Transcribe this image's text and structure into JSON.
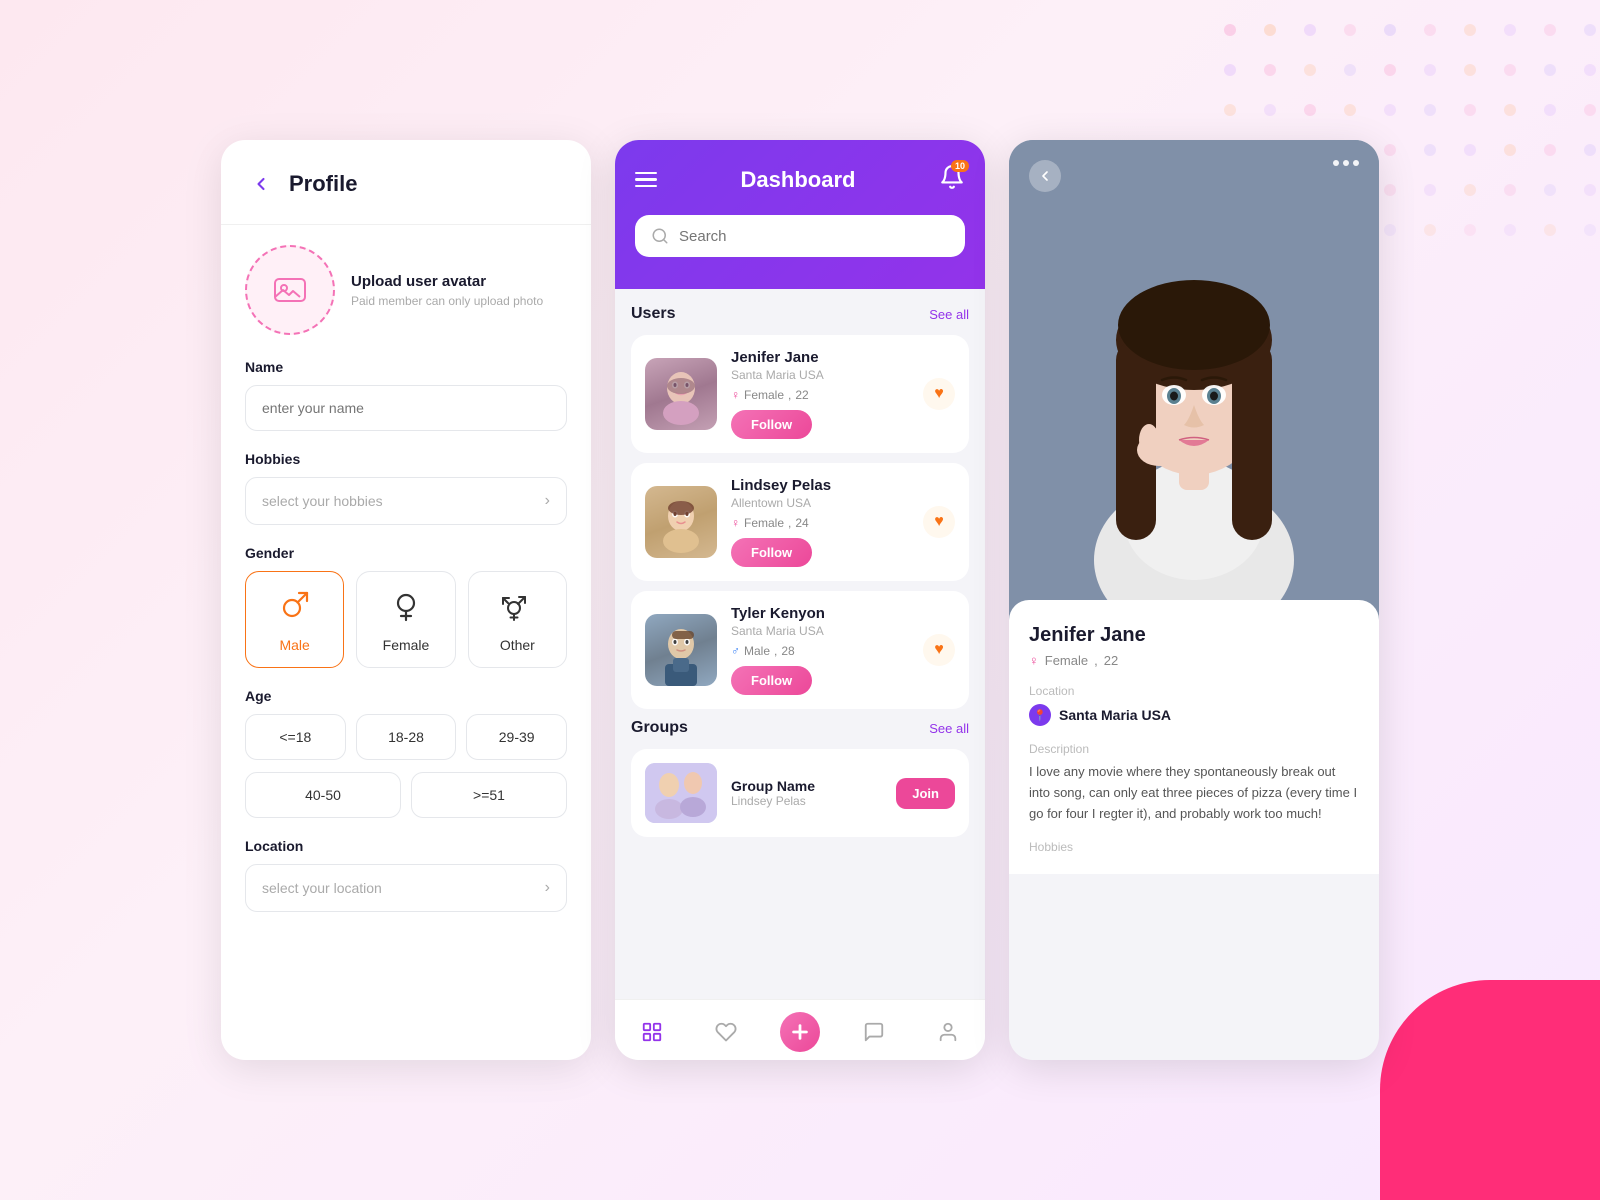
{
  "background": {
    "accentColor": "#f97316",
    "purpleColor": "#7c3aed",
    "pinkColor": "#ec4899"
  },
  "panel1": {
    "title": "Profile",
    "backLabel": "←",
    "avatar": {
      "uploadLabel": "Upload user avatar",
      "subLabel": "Paid member can only upload photo"
    },
    "nameField": {
      "label": "Name",
      "placeholder": "enter your name"
    },
    "hobbiesField": {
      "label": "Hobbies",
      "placeholder": "select your hobbies"
    },
    "genderField": {
      "label": "Gender",
      "options": [
        {
          "id": "male",
          "label": "Male",
          "active": true
        },
        {
          "id": "female",
          "label": "Female",
          "active": false
        },
        {
          "id": "other",
          "label": "Other",
          "active": false
        }
      ]
    },
    "ageField": {
      "label": "Age",
      "options1": [
        "<=18",
        "18-28",
        "29-39"
      ],
      "options2": [
        "40-50",
        ">=51"
      ]
    },
    "locationField": {
      "label": "Location",
      "placeholder": "select your location"
    }
  },
  "panel2": {
    "title": "Dashboard",
    "notifCount": "10",
    "search": {
      "placeholder": "Search"
    },
    "users": {
      "sectionTitle": "Users",
      "seeAll": "See all",
      "followLabel": "Follow",
      "items": [
        {
          "name": "Jenifer Jane",
          "location": "Santa Maria USA",
          "gender": "Female",
          "age": "22",
          "genderSymbol": "♀"
        },
        {
          "name": "Lindsey Pelas",
          "location": "Allentown USA",
          "gender": "Female",
          "age": "24",
          "genderSymbol": "♀"
        },
        {
          "name": "Tyler Kenyon",
          "location": "Santa Maria USA",
          "gender": "Male",
          "age": "28",
          "genderSymbol": "♂"
        }
      ]
    },
    "groups": {
      "sectionTitle": "Groups",
      "seeAll": "See all",
      "joinLabel": "Join",
      "items": [
        {
          "name": "Group Name",
          "sub": "Lindsey Pelas"
        }
      ]
    },
    "nav": {
      "items": [
        "⊞",
        "♥",
        "+",
        "✉",
        "👤"
      ]
    }
  },
  "panel3": {
    "backLabel": "←",
    "user": {
      "name": "Jenifer Jane",
      "gender": "Female",
      "age": "22",
      "genderSymbol": "♀",
      "locationLabel": "Location",
      "location": "Santa Maria USA",
      "descriptionLabel": "Description",
      "description": "I love any movie where they spontaneously break out into song, can only eat three pieces of pizza (every time I go for  four I regter it), and probably work too much!",
      "hobbiesLabel": "Hobbies"
    }
  }
}
